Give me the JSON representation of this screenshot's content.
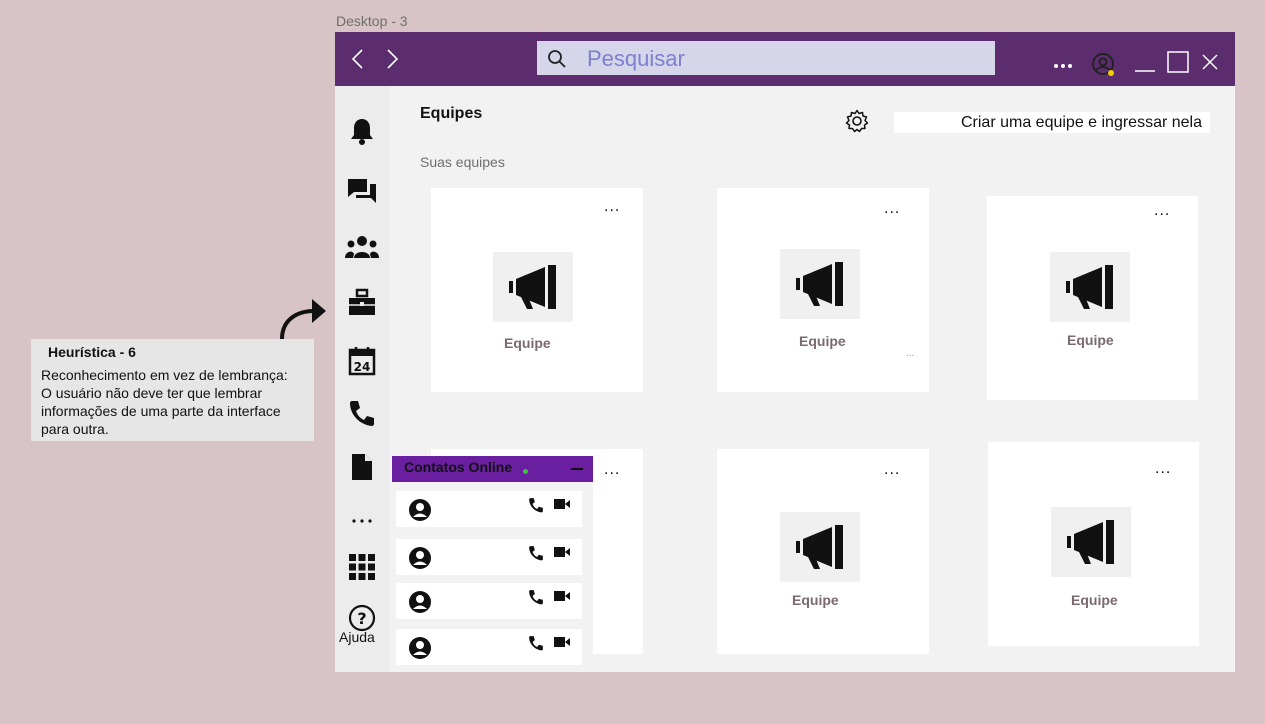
{
  "frame_label": "Desktop - 3",
  "titlebar": {
    "search_placeholder": "Pesquisar",
    "more_label": "..."
  },
  "main": {
    "title": "Equipes",
    "subtitle": "Suas equipes",
    "create_button": "Criar uma equipe  e ingressar nela",
    "cards": [
      {
        "label": "Equipe",
        "more": "...",
        "extra": ""
      },
      {
        "label": "Equipe",
        "more": "...",
        "extra": "..."
      },
      {
        "label": "Equipe",
        "more": "...",
        "extra": ""
      },
      {
        "label": "",
        "more": "...",
        "extra": ""
      },
      {
        "label": "Equipe",
        "more": "...",
        "extra": ""
      },
      {
        "label": "Equipe",
        "more": "...",
        "extra": ""
      }
    ]
  },
  "rail": {
    "more_label": "...",
    "help_label": "Ajuda",
    "icons": [
      "bell-icon",
      "chat-icon",
      "teams-icon",
      "briefcase-icon",
      "calendar-icon",
      "phone-icon",
      "file-icon",
      "more-icon",
      "apps-grid-icon",
      "help-icon"
    ]
  },
  "contacts": {
    "title": "Contatos Online",
    "status_color": "#3dbf4a",
    "rows": 4
  },
  "note": {
    "title": "Heurística  -  6",
    "body": "Reconhecimento em vez de lembrança:\n O usuário não deve ter que lembrar\ninformações de uma parte da interface\n para outra."
  },
  "colors": {
    "titlebar": "#5c2d6e",
    "contacts_header": "#6a1fa0",
    "background": "#d8c3c6"
  }
}
